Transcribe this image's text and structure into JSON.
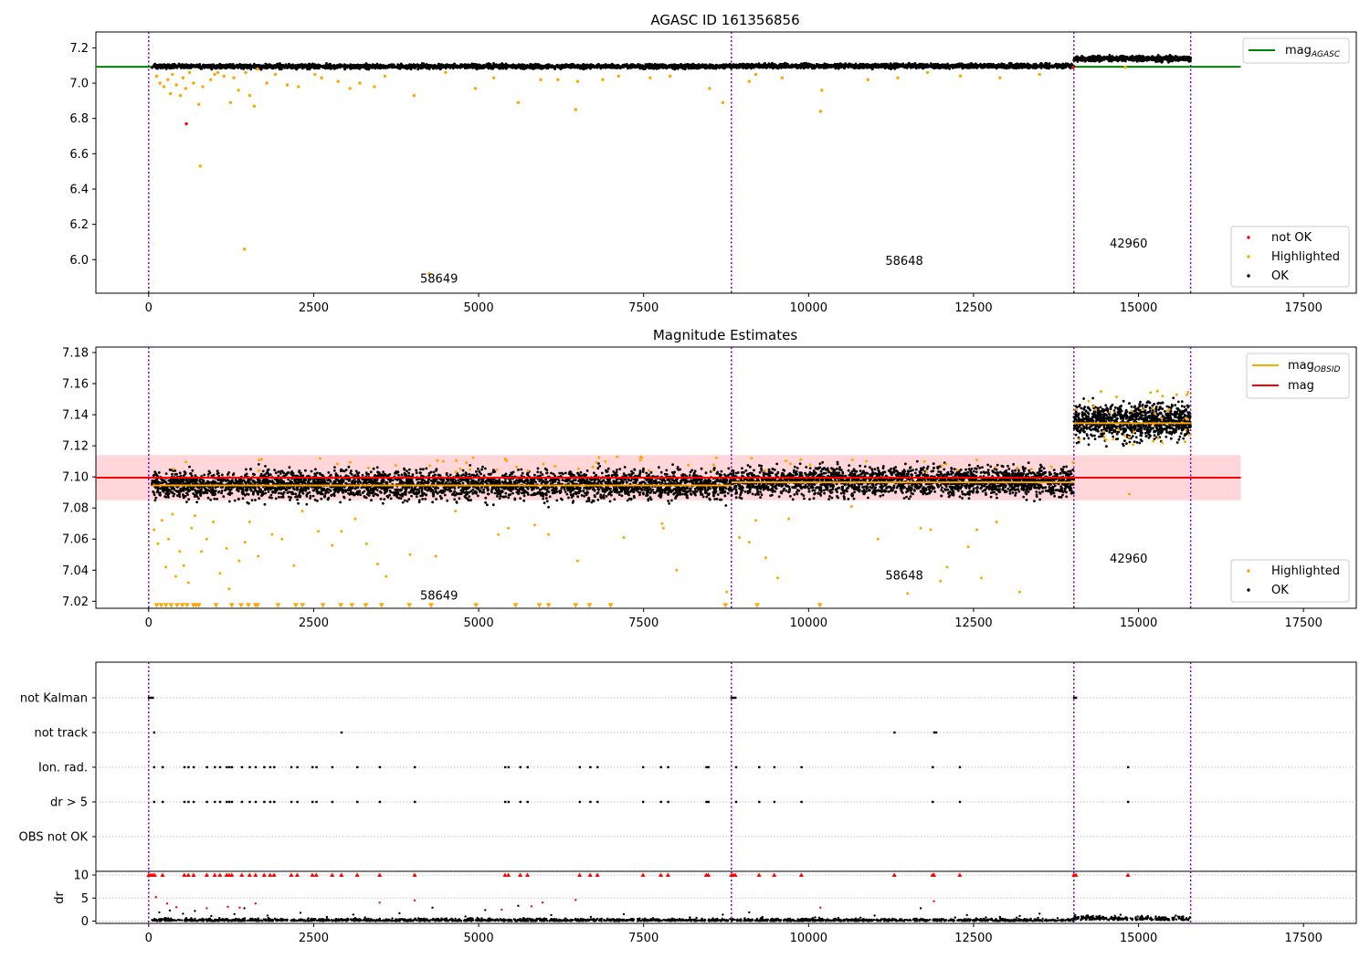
{
  "figure": {
    "panel1_title": "AGASC ID 161356856",
    "panel2_title": "Magnitude Estimates",
    "dr_ylabel": "dr"
  },
  "colors": {
    "ok": "#000000",
    "highlighted": "#ffa500",
    "not_ok": "#ff0000",
    "agasc_line": "#008000",
    "mag_line": "#ff0000",
    "mag_obsid_line": "#ffa500",
    "band": "#ffd6da",
    "obs_boundary": "#7b00b4",
    "grid": "#b0b0b0"
  },
  "chart_data": [
    {
      "type": "scatter",
      "title": "AGASC ID 161356856",
      "xlim": [
        -800,
        18300
      ],
      "ylim": [
        5.81,
        7.29
      ],
      "xticks": [
        0,
        2500,
        5000,
        7500,
        10000,
        12500,
        15000,
        17500
      ],
      "yticks": [
        6.0,
        6.2,
        6.4,
        6.6,
        6.8,
        7.0,
        7.2
      ],
      "legend_position": "top-right",
      "legend_lower_position": "bottom-right",
      "legend_entries": [
        {
          "label_main": "mag",
          "label_sub": "AGASC",
          "kind": "line",
          "color": "#008000"
        }
      ],
      "legend_lower_entries": [
        {
          "label": "not OK",
          "kind": "dot",
          "color": "#ff0000"
        },
        {
          "label": "Highlighted",
          "kind": "dot",
          "color": "#ffa500"
        },
        {
          "label": "OK",
          "kind": "dot",
          "color": "#000000"
        }
      ],
      "reference_lines": [
        {
          "name": "mag_AGASC",
          "y": 7.093,
          "x_range": [
            -800,
            16550
          ],
          "color": "#008000"
        }
      ],
      "obs_boundaries_x": [
        0,
        8830,
        14020,
        15790
      ],
      "obs_labels": [
        {
          "text": "58649",
          "x": 4400,
          "y": 5.87
        },
        {
          "text": "58648",
          "x": 11450,
          "y": 5.97
        },
        {
          "text": "42960",
          "x": 14850,
          "y": 6.07
        }
      ],
      "ok_segments": [
        {
          "x_range": [
            50,
            8830
          ],
          "y_center": 7.095,
          "spread": 0.012
        },
        {
          "x_range": [
            8830,
            14020
          ],
          "y_center": 7.097,
          "spread": 0.012
        },
        {
          "x_range": [
            14020,
            15790
          ],
          "y_center": 7.138,
          "spread": 0.014
        }
      ],
      "highlighted_points": [
        [
          120,
          7.04
        ],
        [
          170,
          7.0
        ],
        [
          230,
          6.98
        ],
        [
          290,
          7.02
        ],
        [
          330,
          6.94
        ],
        [
          360,
          7.05
        ],
        [
          420,
          6.99
        ],
        [
          480,
          6.93
        ],
        [
          520,
          7.03
        ],
        [
          560,
          6.97
        ],
        [
          620,
          7.06
        ],
        [
          680,
          7.0
        ],
        [
          760,
          6.88
        ],
        [
          780,
          6.53
        ],
        [
          820,
          6.98
        ],
        [
          940,
          7.02
        ],
        [
          1000,
          7.05
        ],
        [
          1050,
          7.06
        ],
        [
          1140,
          7.04
        ],
        [
          1240,
          6.89
        ],
        [
          1290,
          7.03
        ],
        [
          1360,
          6.96
        ],
        [
          1450,
          6.06
        ],
        [
          1470,
          7.06
        ],
        [
          1530,
          6.93
        ],
        [
          1600,
          6.87
        ],
        [
          1650,
          7.08
        ],
        [
          1790,
          7.0
        ],
        [
          1920,
          7.05
        ],
        [
          2100,
          6.99
        ],
        [
          2270,
          6.98
        ],
        [
          2520,
          7.05
        ],
        [
          2620,
          7.03
        ],
        [
          2870,
          7.01
        ],
        [
          3050,
          6.97
        ],
        [
          3200,
          7.0
        ],
        [
          3420,
          6.98
        ],
        [
          3580,
          7.04
        ],
        [
          4020,
          6.93
        ],
        [
          4250,
          5.92
        ],
        [
          4500,
          7.06
        ],
        [
          4950,
          6.97
        ],
        [
          5230,
          7.03
        ],
        [
          5600,
          6.89
        ],
        [
          5940,
          7.02
        ],
        [
          6200,
          7.02
        ],
        [
          6470,
          6.85
        ],
        [
          6500,
          7.01
        ],
        [
          6880,
          7.02
        ],
        [
          7120,
          7.04
        ],
        [
          7600,
          7.03
        ],
        [
          7900,
          7.04
        ],
        [
          8500,
          6.97
        ],
        [
          8700,
          6.89
        ],
        [
          9100,
          7.01
        ],
        [
          9200,
          7.05
        ],
        [
          9600,
          7.03
        ],
        [
          10180,
          6.84
        ],
        [
          10200,
          6.96
        ],
        [
          10900,
          7.02
        ],
        [
          11350,
          7.03
        ],
        [
          11800,
          7.06
        ],
        [
          12300,
          7.04
        ],
        [
          12900,
          7.03
        ],
        [
          13500,
          7.05
        ],
        [
          14800,
          7.09
        ]
      ],
      "not_ok_points": [
        [
          570,
          6.77
        ],
        [
          14010,
          7.09
        ]
      ]
    },
    {
      "type": "scatter",
      "title": "Magnitude Estimates",
      "xlim": [
        -800,
        18300
      ],
      "ylim": [
        7.0155,
        7.1835
      ],
      "xticks": [
        0,
        2500,
        5000,
        7500,
        10000,
        12500,
        15000,
        17500
      ],
      "yticks": [
        7.02,
        7.04,
        7.06,
        7.08,
        7.1,
        7.12,
        7.14,
        7.16,
        7.18
      ],
      "legend_position": "top-right",
      "legend_lower_position": "bottom-right",
      "legend_entries": [
        {
          "label_main": "mag",
          "label_sub": "OBSID",
          "kind": "line",
          "color": "#ffa500"
        },
        {
          "label_main": "mag",
          "label_sub": "",
          "kind": "line",
          "color": "#ff0000"
        }
      ],
      "legend_lower_entries": [
        {
          "label": "Highlighted",
          "kind": "dot",
          "color": "#ffa500"
        },
        {
          "label": "OK",
          "kind": "dot",
          "color": "#000000"
        }
      ],
      "band": {
        "y_range": [
          7.085,
          7.114
        ],
        "x_range": [
          -800,
          16550
        ]
      },
      "reference_lines": [
        {
          "name": "mag",
          "y": 7.0995,
          "x_range": [
            -800,
            16550
          ],
          "color": "#ff0000"
        }
      ],
      "obsid_lines": [
        {
          "y": 7.0945,
          "x_range": [
            50,
            8830
          ]
        },
        {
          "y": 7.0965,
          "x_range": [
            8830,
            14020
          ]
        },
        {
          "y": 7.1345,
          "x_range": [
            14020,
            15790
          ]
        }
      ],
      "obs_boundaries_x": [
        0,
        8830,
        14020,
        15790
      ],
      "obs_labels": [
        {
          "text": "58649",
          "x": 4400,
          "y": 7.021
        },
        {
          "text": "58648",
          "x": 11450,
          "y": 7.034
        },
        {
          "text": "42960",
          "x": 14850,
          "y": 7.045
        }
      ],
      "ok_segments": [
        {
          "x_range": [
            50,
            8830
          ],
          "y_center": 7.095,
          "spread": 0.009
        },
        {
          "x_range": [
            8830,
            14020
          ],
          "y_center": 7.097,
          "spread": 0.009
        },
        {
          "x_range": [
            14020,
            15790
          ],
          "y_center": 7.136,
          "spread": 0.011
        }
      ],
      "highlighted_points": [
        [
          80,
          7.066
        ],
        [
          140,
          7.057
        ],
        [
          200,
          7.072
        ],
        [
          260,
          7.042
        ],
        [
          300,
          7.06
        ],
        [
          360,
          7.076
        ],
        [
          410,
          7.036
        ],
        [
          470,
          7.052
        ],
        [
          530,
          7.043
        ],
        [
          600,
          7.032
        ],
        [
          650,
          7.067
        ],
        [
          700,
          7.075
        ],
        [
          800,
          7.052
        ],
        [
          880,
          7.06
        ],
        [
          980,
          7.071
        ],
        [
          1080,
          7.038
        ],
        [
          1180,
          7.054
        ],
        [
          1220,
          7.028
        ],
        [
          1370,
          7.046
        ],
        [
          1460,
          7.058
        ],
        [
          1530,
          7.071
        ],
        [
          1660,
          7.049
        ],
        [
          1870,
          7.063
        ],
        [
          2020,
          7.06
        ],
        [
          2200,
          7.043
        ],
        [
          2330,
          7.078
        ],
        [
          2570,
          7.065
        ],
        [
          2780,
          7.056
        ],
        [
          2920,
          7.065
        ],
        [
          3130,
          7.073
        ],
        [
          3300,
          7.057
        ],
        [
          3470,
          7.044
        ],
        [
          3600,
          7.036
        ],
        [
          3960,
          7.05
        ],
        [
          4350,
          7.049
        ],
        [
          4650,
          7.078
        ],
        [
          5300,
          7.063
        ],
        [
          5450,
          7.067
        ],
        [
          5850,
          7.069
        ],
        [
          6060,
          7.063
        ],
        [
          6500,
          7.046
        ],
        [
          7200,
          7.061
        ],
        [
          7780,
          7.07
        ],
        [
          7800,
          7.067
        ],
        [
          8000,
          7.04
        ],
        [
          8760,
          7.026
        ],
        [
          8950,
          7.061
        ],
        [
          9100,
          7.058
        ],
        [
          9200,
          7.072
        ],
        [
          9350,
          7.048
        ],
        [
          9530,
          7.035
        ],
        [
          9700,
          7.073
        ],
        [
          10650,
          7.081
        ],
        [
          11050,
          7.06
        ],
        [
          11500,
          7.025
        ],
        [
          11700,
          7.067
        ],
        [
          11850,
          7.066
        ],
        [
          12000,
          7.033
        ],
        [
          12100,
          7.042
        ],
        [
          12420,
          7.055
        ],
        [
          12550,
          7.066
        ],
        [
          12620,
          7.035
        ],
        [
          12850,
          7.071
        ],
        [
          13200,
          7.026
        ],
        [
          14860,
          7.089
        ]
      ],
      "highlighted_floor_x": [
        120,
        190,
        260,
        340,
        430,
        510,
        580,
        680,
        720,
        760,
        1020,
        1260,
        1400,
        1510,
        1620,
        1650,
        1960,
        2230,
        2330,
        2640,
        2910,
        3080,
        3290,
        3530,
        3950,
        4280,
        4960,
        5560,
        5920,
        6060,
        6470,
        6680,
        7000,
        8740,
        9220,
        10170
      ],
      "highlighted_floor_y": 7.017
    },
    {
      "type": "scatter",
      "title": "",
      "xlim": [
        -800,
        18300
      ],
      "xticks": [
        0,
        2500,
        5000,
        7500,
        10000,
        12500,
        15000,
        17500
      ],
      "categories": [
        "not Kalman",
        "not track",
        "Ion. rad.",
        "dr > 5",
        "OBS not OK"
      ],
      "obs_boundaries_x": [
        0,
        8830,
        14020,
        15790
      ],
      "category_points": {
        "not Kalman": [
          0,
          30,
          60,
          8830,
          8860,
          8890,
          14020,
          14050
        ],
        "not track": [
          80,
          2920,
          11300,
          11900,
          11930
        ],
        "Ion. rad.": [
          80,
          210,
          540,
          600,
          680,
          880,
          1000,
          1080,
          1180,
          1220,
          1260,
          1410,
          1530,
          1620,
          1750,
          1840,
          1900,
          2160,
          2250,
          2480,
          2540,
          2780,
          3160,
          3500,
          4030,
          5400,
          5450,
          5630,
          5740,
          6530,
          6690,
          6800,
          7490,
          7760,
          7870,
          8450,
          8480,
          8900,
          9250,
          9480,
          9890,
          11880,
          12290,
          14840
        ],
        "dr > 5": [
          80,
          210,
          540,
          600,
          680,
          880,
          1000,
          1080,
          1180,
          1220,
          1260,
          1410,
          1530,
          1620,
          1750,
          1840,
          1900,
          2160,
          2250,
          2480,
          2540,
          2780,
          3160,
          3500,
          4030,
          5400,
          5450,
          5630,
          5740,
          6530,
          6690,
          6800,
          7490,
          7760,
          7870,
          8450,
          8480,
          8900,
          9250,
          9480,
          9890,
          11880,
          12290,
          14840
        ],
        "OBS not OK": []
      }
    },
    {
      "type": "scatter",
      "title": "",
      "ylabel": "dr",
      "xlim": [
        -800,
        18300
      ],
      "ylim": [
        -0.5,
        10.8
      ],
      "xticks": [
        0,
        2500,
        5000,
        7500,
        10000,
        12500,
        15000,
        17500
      ],
      "yticks": [
        0,
        5,
        10
      ],
      "grid": true,
      "obs_boundaries_x": [
        0,
        8830,
        14020,
        15790
      ],
      "dr_clip_x": [
        0,
        30,
        60,
        90,
        210,
        540,
        600,
        680,
        880,
        1000,
        1080,
        1180,
        1220,
        1260,
        1410,
        1530,
        1620,
        1750,
        1840,
        1900,
        2160,
        2250,
        2480,
        2540,
        2780,
        2920,
        3160,
        3500,
        4030,
        5400,
        5450,
        5630,
        5740,
        6530,
        6690,
        6800,
        7490,
        7760,
        7870,
        8450,
        8480,
        8830,
        8860,
        8890,
        9250,
        9480,
        9890,
        11300,
        11880,
        11900,
        12290,
        14020,
        14050,
        14840
      ],
      "dr_clip_y": 10,
      "dr_red_points": [
        [
          110,
          5.2
        ],
        [
          280,
          3.8
        ],
        [
          420,
          3.0
        ],
        [
          880,
          2.8
        ],
        [
          1200,
          3.1
        ],
        [
          1380,
          2.9
        ],
        [
          1620,
          3.8
        ],
        [
          3500,
          4.0
        ],
        [
          4030,
          4.5
        ],
        [
          5350,
          2.5
        ],
        [
          5800,
          3.2
        ],
        [
          5970,
          4.0
        ],
        [
          6470,
          4.6
        ],
        [
          10180,
          2.9
        ],
        [
          11900,
          4.3
        ]
      ],
      "dr_black_outliers": [
        [
          160,
          1.9
        ],
        [
          320,
          2.3
        ],
        [
          520,
          1.6
        ],
        [
          700,
          2.2
        ],
        [
          950,
          1.1
        ],
        [
          1300,
          1.5
        ],
        [
          1450,
          2.8
        ],
        [
          1800,
          1.2
        ],
        [
          2300,
          1.8
        ],
        [
          2700,
          0.9
        ],
        [
          3100,
          1.4
        ],
        [
          3800,
          1.7
        ],
        [
          4300,
          2.9
        ],
        [
          4800,
          1.0
        ],
        [
          5100,
          2.4
        ],
        [
          5600,
          3.3
        ],
        [
          6100,
          1.3
        ],
        [
          6700,
          0.9
        ],
        [
          7200,
          1.5
        ],
        [
          8200,
          0.8
        ],
        [
          8700,
          1.4
        ],
        [
          9100,
          1.9
        ],
        [
          9300,
          0.9
        ],
        [
          10100,
          0.8
        ],
        [
          11000,
          1.2
        ],
        [
          11700,
          2.8
        ],
        [
          12400,
          1.3
        ],
        [
          12900,
          0.9
        ],
        [
          13200,
          1.1
        ],
        [
          13500,
          1.6
        ]
      ]
    }
  ]
}
